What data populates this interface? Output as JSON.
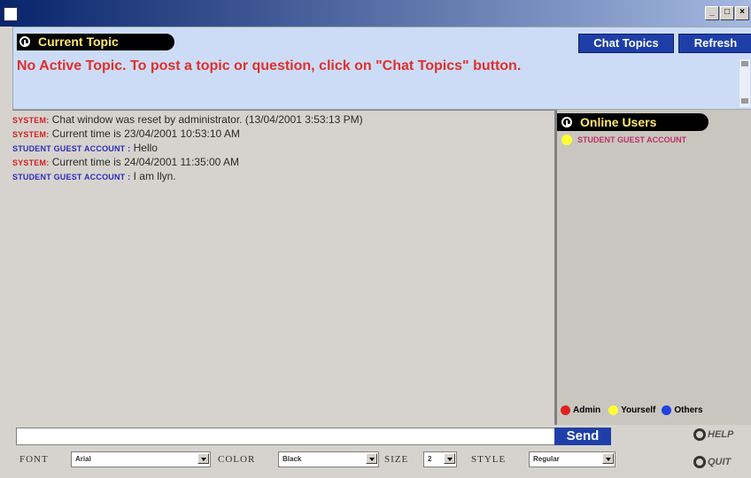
{
  "window": {
    "title": "",
    "controls": {
      "minimize": "_",
      "maximize": "□",
      "close": "×"
    }
  },
  "topic": {
    "header_label": "Current Topic",
    "chat_topics_button": "Chat Topics",
    "refresh_button": "Refresh",
    "text": "No Active Topic. To post a topic or question, click on \"Chat Topics\" button."
  },
  "messages": [
    {
      "sender": "SYSTEM:",
      "kind": "system",
      "text": "Chat window was reset by administrator. (13/04/2001 3:53:13 PM)"
    },
    {
      "sender": "SYSTEM:",
      "kind": "system",
      "text": "Current time is 23/04/2001 10:53:10 AM"
    },
    {
      "sender": "STUDENT GUEST ACCOUNT :",
      "kind": "student",
      "text": "Hello"
    },
    {
      "sender": "SYSTEM:",
      "kind": "system",
      "text": "Current time is 24/04/2001 11:35:00 AM"
    },
    {
      "sender": "STUDENT GUEST ACCOUNT :",
      "kind": "student",
      "text": "I am llyn."
    }
  ],
  "users": {
    "header_label": "Online Users",
    "list": [
      {
        "name": "STUDENT GUEST ACCOUNT",
        "status_color": "#ffff33"
      }
    ],
    "legend": {
      "admin": "Admin",
      "yourself": "Yourself",
      "others": "Others"
    },
    "colors": {
      "admin": "#e02020",
      "yourself": "#ffff33",
      "others": "#2040e0"
    }
  },
  "composer": {
    "input_value": "",
    "send_button": "Send",
    "help_label": "HELP",
    "quit_label": "QUIT"
  },
  "format": {
    "font_label": "FONT",
    "font_value": "Arial",
    "color_label": "COLOR",
    "color_value": "Black",
    "size_label": "SIZE",
    "size_value": "2",
    "style_label": "STYLE",
    "style_value": "Regular"
  }
}
